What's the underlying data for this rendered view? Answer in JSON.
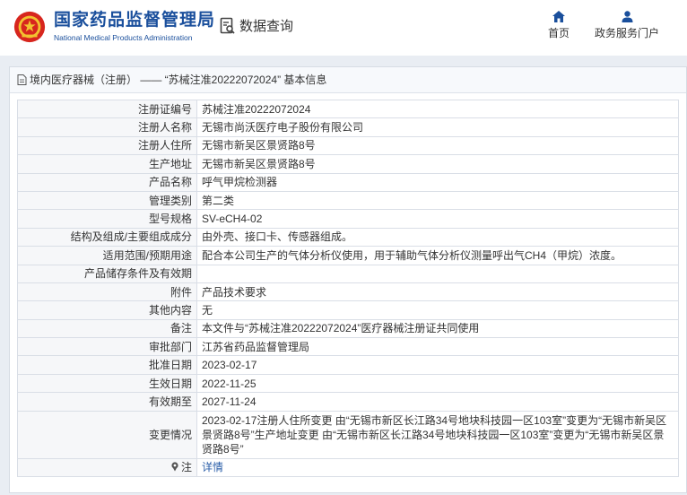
{
  "header": {
    "title_cn": "国家药品监督管理局",
    "title_en": "National Medical Products Administration",
    "query_label": "数据查询",
    "nav": [
      {
        "label": "首页",
        "icon": "home-icon"
      },
      {
        "label": "政务服务门户",
        "icon": "user-icon"
      }
    ]
  },
  "panel": {
    "title": "境内医疗器械（注册） —— “苏械注准20222072024” 基本信息"
  },
  "rows": [
    {
      "label": "注册证编号",
      "value": "苏械注准20222072024"
    },
    {
      "label": "注册人名称",
      "value": "无锡市尚沃医疗电子股份有限公司"
    },
    {
      "label": "注册人住所",
      "value": "无锡市新吴区景贤路8号"
    },
    {
      "label": "生产地址",
      "value": "无锡市新吴区景贤路8号"
    },
    {
      "label": "产品名称",
      "value": "呼气甲烷检测器"
    },
    {
      "label": "管理类别",
      "value": "第二类"
    },
    {
      "label": "型号规格",
      "value": "SV-eCH4-02"
    },
    {
      "label": "结构及组成/主要组成成分",
      "value": "由外壳、接口卡、传感器组成。"
    },
    {
      "label": "适用范围/预期用途",
      "value": "配合本公司生产的气体分析仪使用，用于辅助气体分析仪测量呼出气CH4（甲烷）浓度。"
    },
    {
      "label": "产品储存条件及有效期",
      "value": ""
    },
    {
      "label": "附件",
      "value": "产品技术要求"
    },
    {
      "label": "其他内容",
      "value": "无"
    },
    {
      "label": "备注",
      "value": "本文件与“苏械注准20222072024”医疗器械注册证共同使用"
    },
    {
      "label": "审批部门",
      "value": "江苏省药品监督管理局"
    },
    {
      "label": "批准日期",
      "value": "2023-02-17"
    },
    {
      "label": "生效日期",
      "value": "2022-11-25"
    },
    {
      "label": "有效期至",
      "value": "2027-11-24"
    },
    {
      "label": "变更情况",
      "value": "2023-02-17注册人住所变更 由“无锡市新区长江路34号地块科技园一区103室”变更为“无锡市新吴区景贤路8号”生产地址变更 由“无锡市新区长江路34号地块科技园一区103室”变更为“无锡市新吴区景贤路8号”"
    }
  ],
  "note": {
    "label": "注",
    "link_text": "详情"
  },
  "colors": {
    "brand": "#1a4f9c",
    "emblem_red": "#d7261e",
    "link": "#2a5ea8"
  }
}
